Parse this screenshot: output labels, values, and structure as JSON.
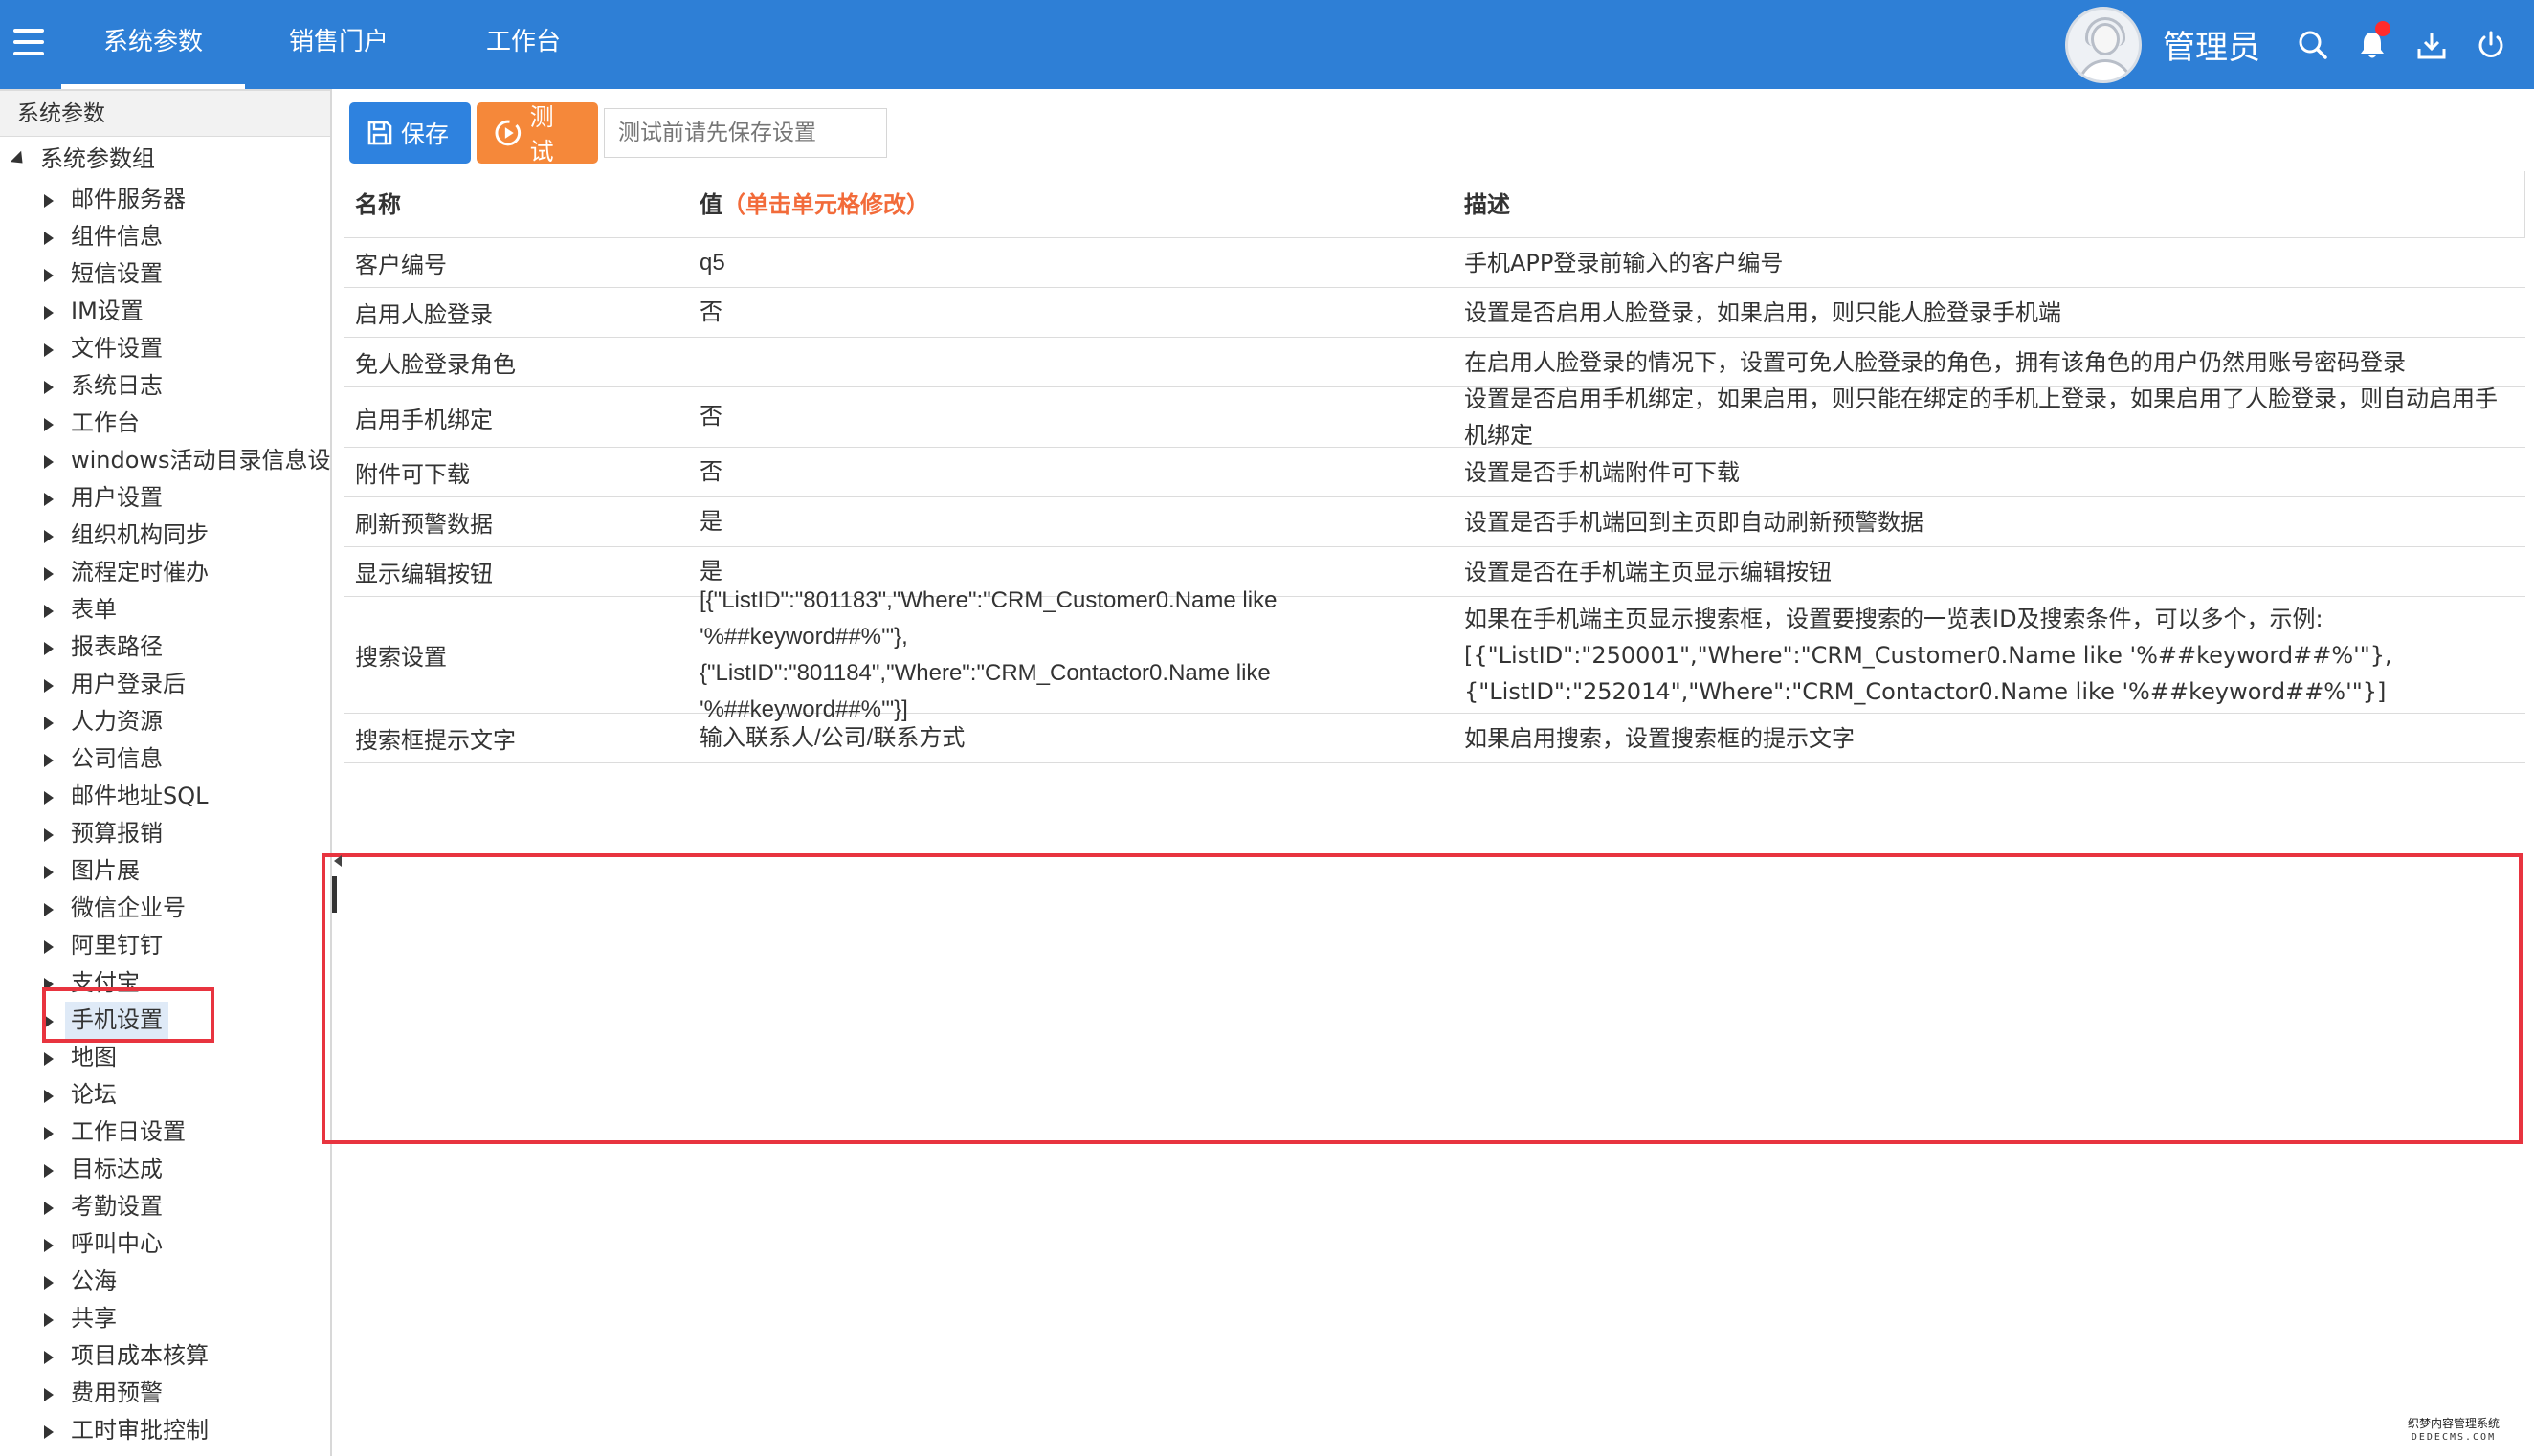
{
  "topbar": {
    "tabs": [
      {
        "label": "系统参数",
        "active": true
      },
      {
        "label": "销售门户",
        "active": false
      },
      {
        "label": "工作台",
        "active": false
      }
    ],
    "username": "管理员",
    "icons": [
      "search-icon",
      "bell-icon",
      "download-icon",
      "power-icon"
    ],
    "color": "#2e7fd6"
  },
  "sidebar": {
    "header": "系统参数",
    "root": "系统参数组",
    "items": [
      "邮件服务器",
      "组件信息",
      "短信设置",
      "IM设置",
      "文件设置",
      "系统日志",
      "工作台",
      "windows活动目录信息设置",
      "用户设置",
      "组织机构同步",
      "流程定时催办",
      "表单",
      "报表路径",
      "用户登录后",
      "人力资源",
      "公司信息",
      "邮件地址SQL",
      "预算报销",
      "图片展",
      "微信企业号",
      "阿里钉钉",
      "支付宝",
      "手机设置",
      "地图",
      "论坛",
      "工作日设置",
      "目标达成",
      "考勤设置",
      "呼叫中心",
      "公海",
      "共享",
      "项目成本核算",
      "费用预警",
      "工时审批控制"
    ],
    "selected": "手机设置"
  },
  "toolbar": {
    "save_label": "保存",
    "test_label": "测试",
    "hint_placeholder": "测试前请先保存设置"
  },
  "grid": {
    "headers": {
      "name": "名称",
      "value": "值",
      "value_hint": "（单击单元格修改）",
      "desc": "描述"
    },
    "rows": [
      {
        "name": "客户编号",
        "value": "q5",
        "desc": "手机APP登录前输入的客户编号"
      },
      {
        "name": "启用人脸登录",
        "value": "否",
        "desc": "设置是否启用人脸登录，如果启用，则只能人脸登录手机端"
      },
      {
        "name": "免人脸登录角色",
        "value": "",
        "desc": "在启用人脸登录的情况下，设置可免人脸登录的角色，拥有该角色的用户仍然用账号密码登录"
      },
      {
        "name": "启用手机绑定",
        "value": "否",
        "desc": "设置是否启用手机绑定，如果启用，则只能在绑定的手机上登录，如果启用了人脸登录，则自动启用手机绑定"
      },
      {
        "name": "附件可下载",
        "value": "否",
        "desc": "设置是否手机端附件可下载"
      },
      {
        "name": "刷新预警数据",
        "value": "是",
        "desc": "设置是否手机端回到主页即自动刷新预警数据"
      },
      {
        "name": "显示编辑按钮",
        "value": "是",
        "desc": "设置是否在手机端主页显示编辑按钮"
      },
      {
        "name": "搜索设置",
        "value": "[{\"ListID\":\"801183\",\"Where\":\"CRM_Customer0.Name like '%##keyword##%'\"},{\"ListID\":\"801184\",\"Where\":\"CRM_Contactor0.Name like '%##keyword##%'\"}]",
        "desc": "如果在手机端主页显示搜索框，设置要搜索的一览表ID及搜索条件，可以多个，示例: [{\"ListID\":\"250001\",\"Where\":\"CRM_Customer0.Name like '%##keyword##%'\"},{\"ListID\":\"252014\",\"Where\":\"CRM_Contactor0.Name like '%##keyword##%'\"}]"
      },
      {
        "name": "搜索框提示文字",
        "value": "输入联系人/公司/联系方式",
        "desc": "如果启用搜索，设置搜索框的提示文字"
      }
    ]
  },
  "watermark": {
    "line1": "织梦内容管理系统",
    "line2": "DEDECMS.COM"
  }
}
